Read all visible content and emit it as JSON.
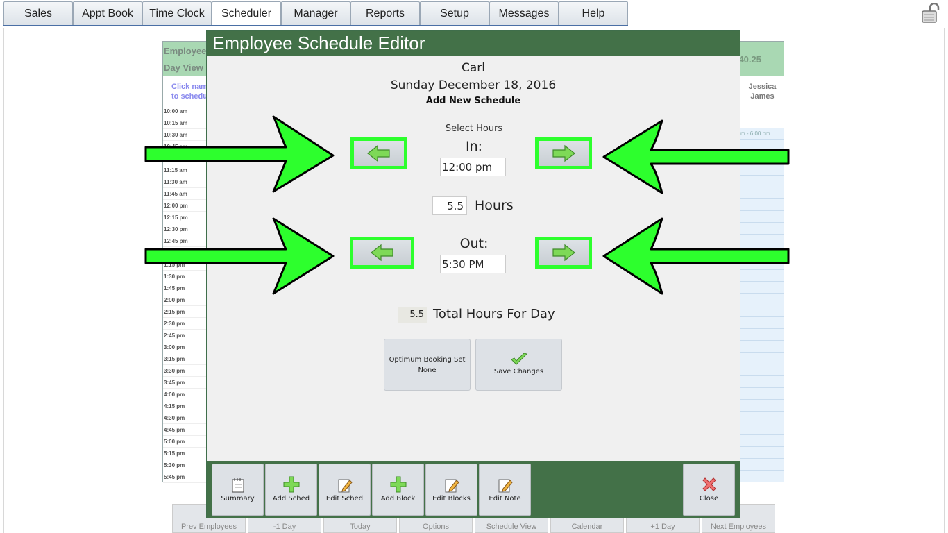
{
  "nav": {
    "tabs": [
      "Sales",
      "Appt Book",
      "Time Clock",
      "Scheduler",
      "Manager",
      "Reports",
      "Setup",
      "Messages",
      "Help"
    ],
    "active": "Scheduler"
  },
  "background": {
    "header_employee": "Employee",
    "header_day": "Day View",
    "header_total": "40.25",
    "click_note_1": "Click nam",
    "click_note_2": "to schedu",
    "times": [
      "10:00 am",
      "10:15 am",
      "10:30 am",
      "10:45 am",
      "11:00 am",
      "11:15 am",
      "11:30 am",
      "11:45 am",
      "12:00 pm",
      "12:15 pm",
      "12:30 pm",
      "12:45 pm",
      "1:00 pm",
      "1:15 pm",
      "1:30 pm",
      "1:45 pm",
      "2:00 pm",
      "2:15 pm",
      "2:30 pm",
      "2:45 pm",
      "3:00 pm",
      "3:15 pm",
      "3:30 pm",
      "3:45 pm",
      "4:00 pm",
      "4:15 pm",
      "4:30 pm",
      "4:45 pm",
      "5:00 pm",
      "5:15 pm",
      "5:30 pm",
      "5:45 pm"
    ],
    "right_name_1": "Jessica",
    "right_name_2": "James",
    "right_slot": "m - 6:00 pm",
    "bottom_buttons": [
      "Prev Employees",
      "-1 Day",
      "Today",
      "Options",
      "Schedule View",
      "Calendar",
      "+1 Day",
      "Next Employees"
    ]
  },
  "modal": {
    "title": "Employee Schedule Editor",
    "employee": "Carl",
    "date": "Sunday December 18, 2016",
    "subtitle": "Add New Schedule",
    "select_hours": "Select Hours",
    "in_label": "In:",
    "in_value": "12:00 pm",
    "hours_value": "5.5",
    "hours_label": "Hours",
    "out_label": "Out:",
    "out_value": "5:30 PM",
    "total_value": "5.5",
    "total_label": "Total Hours For Day",
    "optimum_line1": "Optimum Booking Set",
    "optimum_line2": "None",
    "save_label": "Save Changes",
    "toolbar": {
      "summary": "Summary",
      "add_sched": "Add Sched",
      "edit_sched": "Edit Sched",
      "add_block": "Add Block",
      "edit_blocks": "Edit Blocks",
      "edit_note": "Edit Note",
      "close": "Close"
    }
  },
  "colors": {
    "modal_green": "#437148",
    "highlight_green": "#2dff2d",
    "header_green": "#a9d8b3"
  },
  "icons": [
    "lock-icon",
    "arrow-left-icon",
    "arrow-right-icon",
    "checkmark-icon",
    "notepad-icon",
    "plus-icon",
    "pencil-icon",
    "close-x-icon"
  ]
}
